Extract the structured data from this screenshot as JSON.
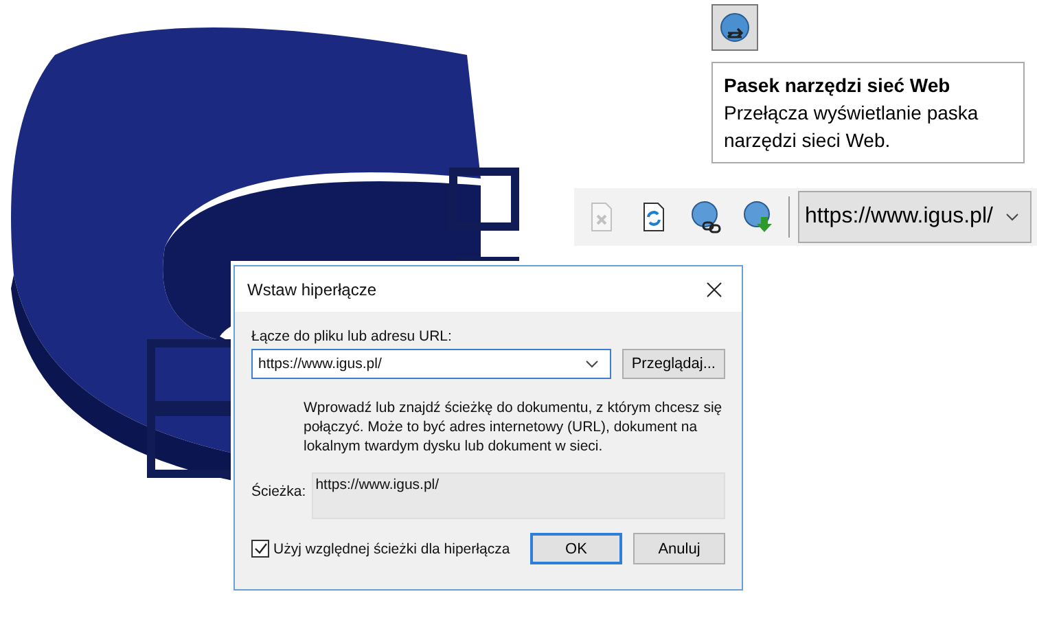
{
  "tooltip": {
    "title": "Pasek narzędzi sieć Web",
    "description": "Przełącza wyświetlanie paska narzędzi sieci Web."
  },
  "toolbar": {
    "buttons": [
      {
        "kind": "delete",
        "disabled": true
      },
      {
        "kind": "refresh",
        "disabled": false
      },
      {
        "kind": "hyperlink",
        "disabled": false
      },
      {
        "kind": "go",
        "disabled": false
      }
    ],
    "url": "https://www.igus.pl/"
  },
  "dialog": {
    "title": "Wstaw hiperłącze",
    "url_label": "Łącze do pliku lub adresu URL:",
    "url_value": "https://www.igus.pl/",
    "browse_button": "Przeglądaj...",
    "help_text": "Wprowadź lub znajdź ścieżkę do dokumentu, z którym chcesz się połączyć.  Może to być adres internetowy (URL), dokument na lokalnym twardym dysku lub dokument w sieci.",
    "path_label": "Ścieżka:",
    "path_value": "https://www.igus.pl/",
    "checkbox": {
      "label": "Użyj względnej ścieżki dla hiperłącza",
      "checked": true
    },
    "buttons": [
      {
        "label": "OK",
        "default": true
      },
      {
        "label": "Anuluj",
        "default": false
      }
    ]
  }
}
